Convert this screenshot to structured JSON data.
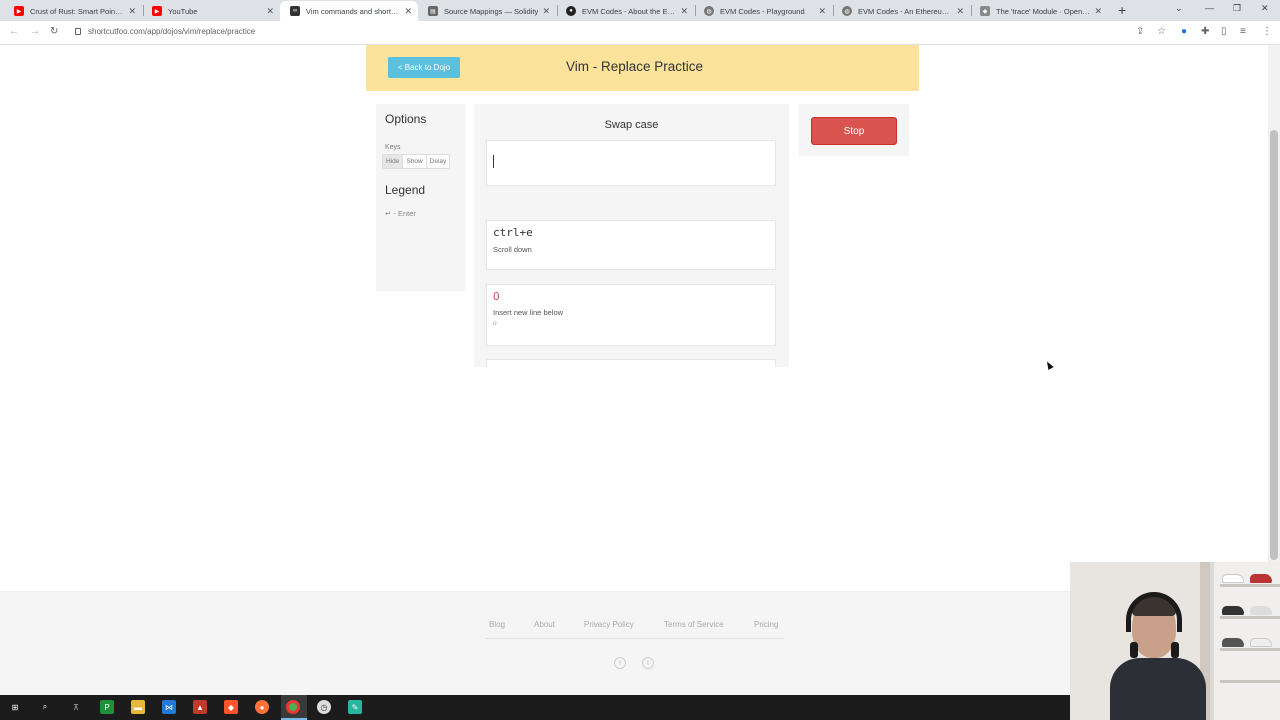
{
  "browser": {
    "tabs": [
      {
        "title": "Crust of Rust: Smart Pointers",
        "icon": "youtube-icon",
        "color": "#ff0000"
      },
      {
        "title": "YouTube",
        "icon": "youtube-icon",
        "color": "#ff0000"
      },
      {
        "title": "Vim commands and shortcuts",
        "icon": "shortcutfoo-icon",
        "color": "#333333"
      },
      {
        "title": "Source Mappings — Solidity",
        "icon": "document-icon",
        "color": "#555555"
      },
      {
        "title": "EVM Codes - About the EVM",
        "icon": "evm-codes-icon",
        "color": "#222222"
      },
      {
        "title": "EVM Codes - Playground",
        "icon": "globe-icon",
        "color": "#555555"
      },
      {
        "title": "EVM Codes - An Ethereum Vi",
        "icon": "globe-icon",
        "color": "#555555"
      },
      {
        "title": "The 'trace' Module · OpenEth",
        "icon": "openethereum-icon",
        "color": "#555555"
      }
    ],
    "url": "shortcutfoo.com/app/dojos/vim/replace/practice"
  },
  "header": {
    "back_label": "< Back to Dojo",
    "title": "Vim - Replace Practice"
  },
  "options": {
    "title": "Options",
    "keys_label": "Keys",
    "key_buttons": [
      "Hide",
      "Show",
      "Delay"
    ],
    "selected": "Hide",
    "legend_title": "Legend",
    "legend_item": "↵ - Enter"
  },
  "practice": {
    "prompt": "Swap case",
    "answer": "",
    "history": [
      {
        "key": "ctrl+e",
        "desc": "Scroll down",
        "correct": true
      },
      {
        "key": "O",
        "desc": "Insert new line below",
        "hint": "o",
        "correct": false
      }
    ]
  },
  "stop_label": "Stop",
  "footer": {
    "links": [
      "Blog",
      "About",
      "Privacy Policy",
      "Terms of Service",
      "Pricing"
    ],
    "social": [
      "facebook-icon",
      "twitter-icon"
    ]
  },
  "colors": {
    "header_band": "#fbe39b",
    "back_button": "#5bc0de",
    "stop_button": "#d9534f",
    "error_key": "#d9534f"
  }
}
